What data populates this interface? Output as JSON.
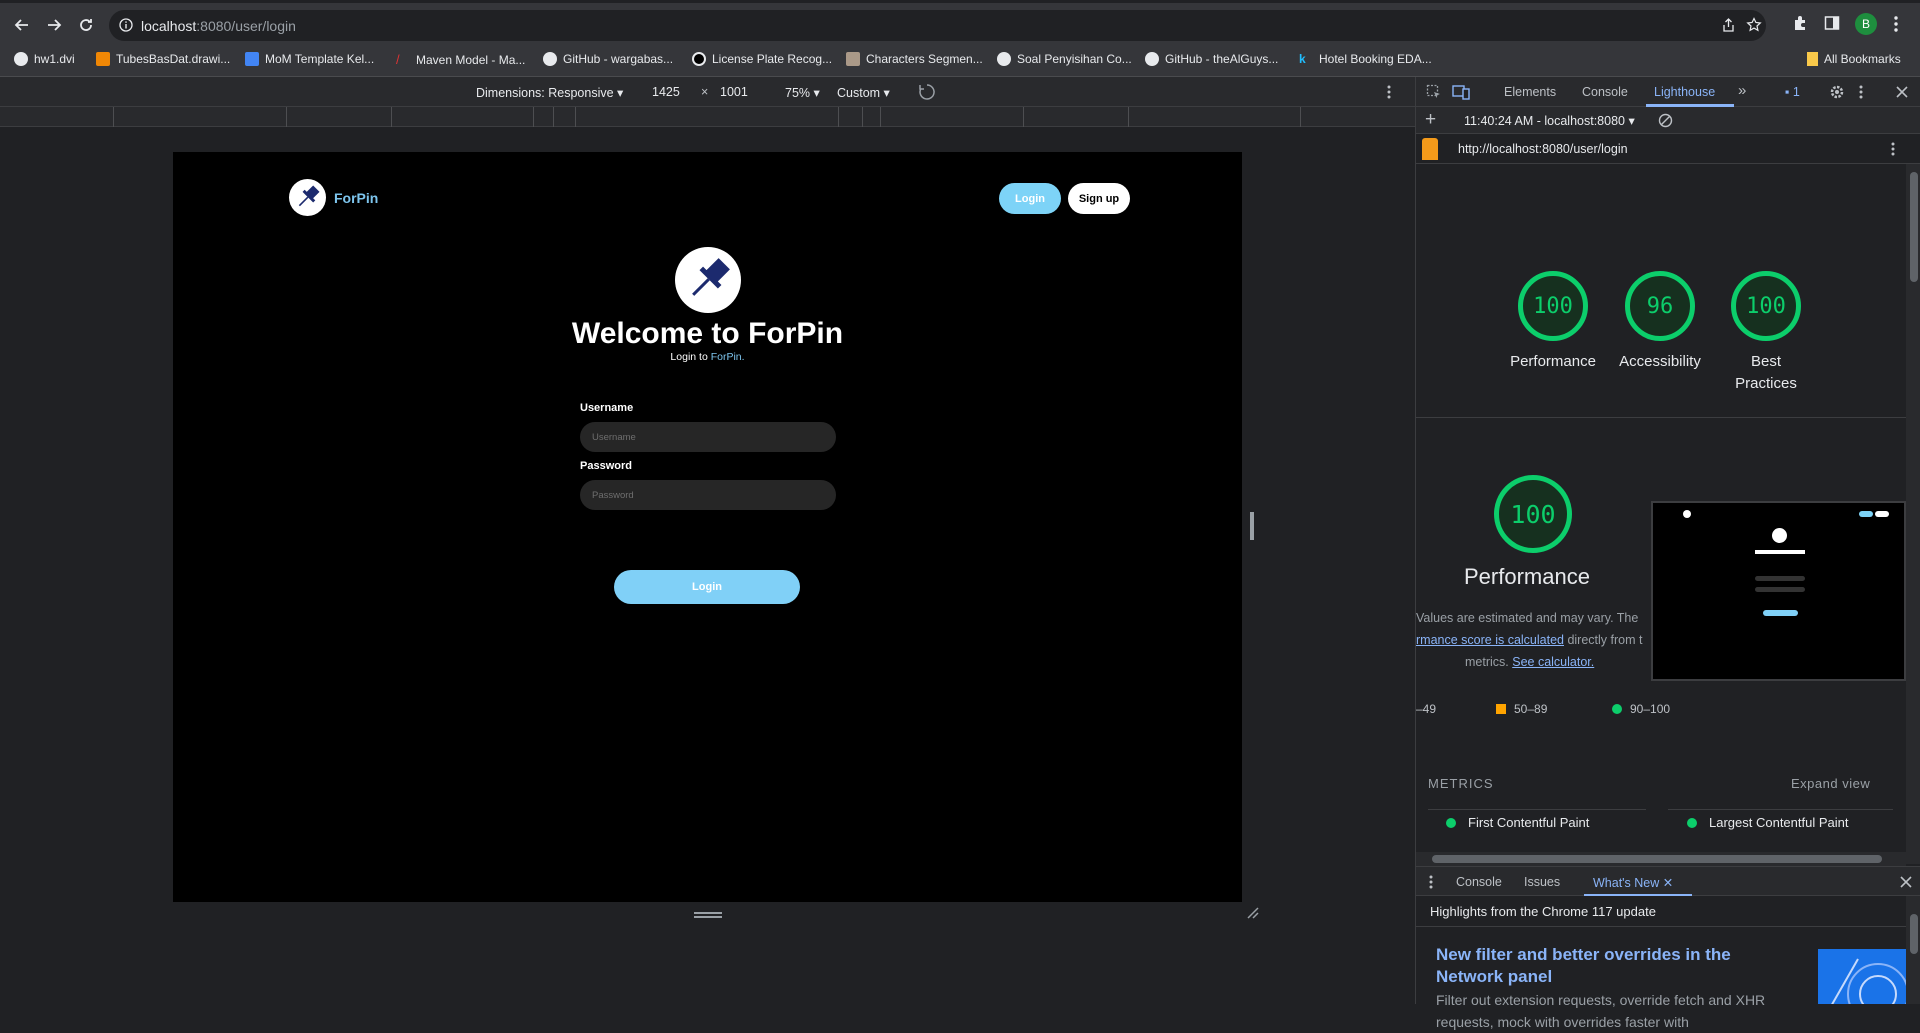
{
  "browser": {
    "url_host": "localhost",
    "url_rest": ":8080/user/login",
    "profile_initial": "B"
  },
  "bookmarks": {
    "items": [
      {
        "label": "hw1.dvi"
      },
      {
        "label": "TubesBasDat.drawi..."
      },
      {
        "label": "MoM Template Kel..."
      },
      {
        "label": "Maven Model - Ma..."
      },
      {
        "label": "GitHub - wargabas..."
      },
      {
        "label": "License Plate Recog..."
      },
      {
        "label": "Characters Segmen..."
      },
      {
        "label": "Soal Penyisihan Co..."
      },
      {
        "label": "GitHub - theAlGuys..."
      },
      {
        "label": "Hotel Booking EDA..."
      }
    ],
    "all_label": "All Bookmarks"
  },
  "device_toolbar": {
    "dimensions": "Dimensions: Responsive",
    "width": "1425",
    "times": "×",
    "height": "1001",
    "zoom": "75%",
    "throttle": "Custom"
  },
  "page": {
    "brand": "ForPin",
    "nav_login": "Login",
    "nav_signup": "Sign up",
    "welcome": "Welcome to ForPin",
    "subtitle_prefix": "Login to ",
    "subtitle_accent": "ForPin.",
    "username_label": "Username",
    "username_placeholder": "Username",
    "password_label": "Password",
    "password_placeholder": "Password",
    "login_button": "Login"
  },
  "devtools": {
    "tabs": [
      "Elements",
      "Console",
      "Lighthouse"
    ],
    "active_tab": "Lighthouse",
    "issues_count": "1",
    "report_time": "11:40:24 AM - localhost:8080",
    "report_url": "http://localhost:8080/user/login",
    "scores": [
      {
        "value": "100",
        "label": "Performance"
      },
      {
        "value": "96",
        "label": "Accessibility"
      },
      {
        "value": "100",
        "label": "Best Practices"
      }
    ],
    "perf_score": "100",
    "perf_title": "Performance",
    "note_line1": "Values are estimated and may vary. The",
    "note_link1": "rmance score is calculated",
    "note_line2_rest": " directly from t",
    "note_line3": "metrics. ",
    "note_link2": "See calculator.",
    "legend": [
      "–49",
      "50–89",
      "90–100"
    ],
    "metrics_label": "METRICS",
    "expand_view": "Expand view",
    "metric1": "First Contentful Paint",
    "metric2": "Largest Contentful Paint",
    "drawer_tabs": [
      "Console",
      "Issues",
      "What's New"
    ],
    "drawer_active": "What's New",
    "drawer_heading": "Highlights from the Chrome 117 update",
    "news_title": "New filter and better overrides in the Network panel",
    "news_body": "Filter out extension requests, override fetch and XHR requests, mock with overrides faster with",
    "colors": {
      "pass": "#0cce6b",
      "average": "#ffa400",
      "accent": "#8ab4f8"
    }
  }
}
